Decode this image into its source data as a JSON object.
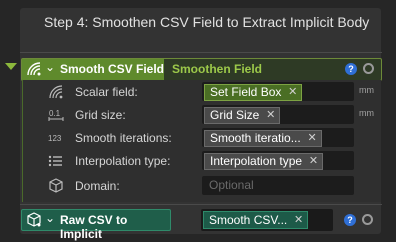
{
  "step": {
    "title": "Step 4: Smoothen CSV Field to Extract Implicit Body"
  },
  "node": {
    "name": "Smooth CSV Field",
    "subtitle": "Smoothen Field",
    "help": "?"
  },
  "params": [
    {
      "icon": "scalar-field-icon",
      "label": "Scalar field:",
      "value": "Set Field Box",
      "style": "green",
      "unit": "mm"
    },
    {
      "icon": "grid-size-icon",
      "label": "Grid size:",
      "value": "Grid Size",
      "style": "gray",
      "unit": "mm"
    },
    {
      "icon": "smooth-iterations-icon",
      "label": "Smooth iterations:",
      "value": "Smooth iteratio...",
      "style": "gray",
      "unit": ""
    },
    {
      "icon": "interpolation-icon",
      "label": "Interpolation type:",
      "value": "Interpolation type",
      "style": "gray",
      "unit": ""
    },
    {
      "icon": "domain-icon",
      "label": "Domain:",
      "placeholder": "Optional"
    }
  ],
  "next_node": {
    "name": "Raw CSV to Implicit",
    "value": "Smooth CSV...",
    "help": "?"
  },
  "glyphs": {
    "remove": "✕",
    "chevron": "⌄"
  },
  "colors": {
    "accent_green": "#5f8a2c",
    "teal": "#1f5e4a",
    "help_blue": "#2f6fd6"
  }
}
